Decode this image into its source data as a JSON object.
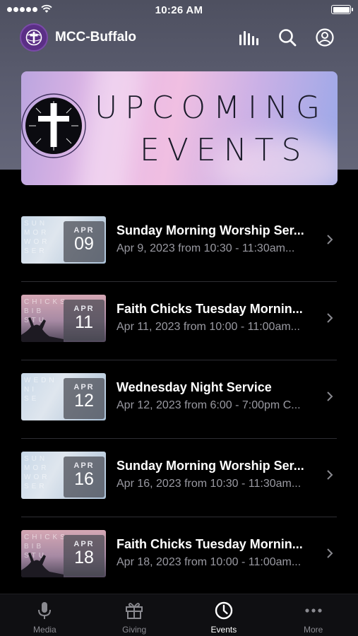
{
  "status_bar": {
    "time": "10:26 AM"
  },
  "header": {
    "title": "MCC-Buffalo"
  },
  "banner": {
    "line1": "UPCOMING",
    "line2": "EVENTS"
  },
  "events": [
    {
      "month": "APR",
      "day": "09",
      "title": "Sunday Morning Worship Ser...",
      "subtitle": "Apr 9, 2023 from 10:30 - 11:30am...",
      "thumb_text": [
        "SUN",
        "MOR",
        "WOR",
        "SER"
      ]
    },
    {
      "month": "APR",
      "day": "11",
      "title": "Faith Chicks Tuesday Mornin...",
      "subtitle": "Apr 11, 2023 from 10:00 - 11:00am...",
      "thumb_text": [
        "CHICKS",
        "BIB",
        "STU"
      ]
    },
    {
      "month": "APR",
      "day": "12",
      "title": "Wednesday Night Service",
      "subtitle": "Apr 12, 2023 from 6:00 - 7:00pm C...",
      "thumb_text": [
        "WEDN",
        "NI",
        "SE"
      ]
    },
    {
      "month": "APR",
      "day": "16",
      "title": "Sunday Morning Worship Ser...",
      "subtitle": "Apr 16, 2023 from 10:30 - 11:30am...",
      "thumb_text": [
        "SUN",
        "MOR",
        "WOR",
        "SER"
      ]
    },
    {
      "month": "APR",
      "day": "18",
      "title": "Faith Chicks Tuesday Mornin...",
      "subtitle": "Apr 18, 2023 from 10:00 - 11:00am...",
      "thumb_text": [
        "CHICKS",
        "BIB",
        "STU"
      ]
    }
  ],
  "tabs": [
    {
      "label": "Media",
      "icon": "microphone-icon",
      "active": false
    },
    {
      "label": "Giving",
      "icon": "gift-icon",
      "active": false
    },
    {
      "label": "Events",
      "icon": "clock-icon",
      "active": true
    },
    {
      "label": "More",
      "icon": "more-dots-icon",
      "active": false
    }
  ],
  "colors": {
    "logo": "#5b2f86",
    "background": "#000000",
    "header_bg": "#5b5d70",
    "subtitle": "#9a9aa2"
  }
}
